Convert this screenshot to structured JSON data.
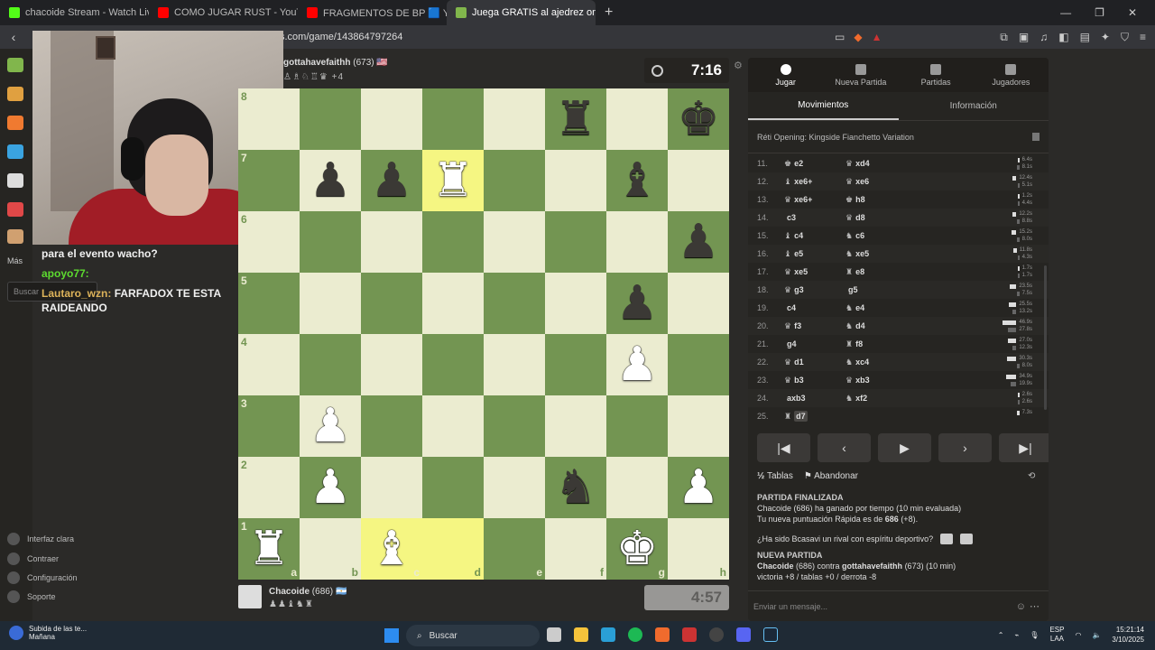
{
  "browser": {
    "tabs": [
      {
        "title": "chacoide Stream - Watch Live on",
        "color": "#53fc18"
      },
      {
        "title": "COMO JUGAR RUST - YouTube",
        "color": "#ff0000"
      },
      {
        "title": "FRAGMENTOS DE BP 🟦 Y ❌CRO",
        "color": "#ff0000"
      },
      {
        "title": "Juega GRATIS al ajedrez online -",
        "color": "#81b64c"
      }
    ],
    "url": "s.com/game/143864797264"
  },
  "sidebar": {
    "mas": "Más",
    "search_placeholder": "Buscar",
    "bottom": [
      "Interfaz clara",
      "Contraer",
      "Configuración",
      "Soporte"
    ]
  },
  "chat": [
    {
      "user": "",
      "text": "para el evento wacho?"
    },
    {
      "user": "apoyo77:",
      "text": "",
      "color": "green"
    },
    {
      "user": "Lautaro_wzn:",
      "text": "FARFADOX TE ESTA RAIDEANDO",
      "color": "orange"
    }
  ],
  "game": {
    "opponent": {
      "name": "gottahavefaithh",
      "rating": "(673)",
      "flag": "🇺🇸",
      "captured": "♙♗♘♖♛ +4"
    },
    "player": {
      "name": "Chacoide",
      "rating": "(686)",
      "flag": "🇦🇷",
      "captured": "♟♟♝♞♜"
    },
    "clock_top": "7:16",
    "clock_bottom": "4:57"
  },
  "board": {
    "ranks": [
      "8",
      "7",
      "6",
      "5",
      "4",
      "3",
      "2",
      "1"
    ],
    "files": [
      "a",
      "b",
      "c",
      "d",
      "e",
      "f",
      "g",
      "h"
    ],
    "position": [
      [
        "",
        "",
        "",
        "",
        "",
        "br",
        "",
        "bk"
      ],
      [
        "",
        "bp",
        "bp",
        "wr",
        "",
        "",
        "bb",
        ""
      ],
      [
        "",
        "",
        "",
        "",
        "",
        "",
        "",
        "bp"
      ],
      [
        "",
        "",
        "",
        "",
        "",
        "",
        "bp",
        ""
      ],
      [
        "",
        "",
        "",
        "",
        "",
        "",
        "wp",
        ""
      ],
      [
        "",
        "wp",
        "",
        "",
        "",
        "",
        "",
        ""
      ],
      [
        "",
        "wp",
        "",
        "",
        "",
        "bn",
        "",
        "wp"
      ],
      [
        "wr",
        "",
        "wb",
        "",
        "",
        "",
        "wk",
        ""
      ]
    ],
    "highlight": [
      "d7",
      "c1",
      "d1"
    ]
  },
  "panel": {
    "tabs": [
      "Jugar",
      "Nueva Partida",
      "Partidas",
      "Jugadores"
    ],
    "subtabs": [
      "Movimientos",
      "Información"
    ],
    "opening": "Réti Opening: Kingside Fianchetto Variation",
    "moves": [
      {
        "n": "11.",
        "w": "e2",
        "wp": "♚",
        "b": "xd4",
        "bp": "♛",
        "tw": "6.4s",
        "tb": "8.1s"
      },
      {
        "n": "12.",
        "w": "xe6+",
        "wp": "♝",
        "b": "xe6",
        "bp": "♛",
        "tw": "12.4s",
        "tb": "5.1s"
      },
      {
        "n": "13.",
        "w": "xe6+",
        "wp": "♛",
        "b": "h8",
        "bp": "♚",
        "tw": "1.2s",
        "tb": "4.4s"
      },
      {
        "n": "14.",
        "w": "c3",
        "wp": "",
        "b": "d8",
        "bp": "♛",
        "tw": "12.2s",
        "tb": "8.8s"
      },
      {
        "n": "15.",
        "w": "c4",
        "wp": "♝",
        "b": "c6",
        "bp": "♞",
        "tw": "15.2s",
        "tb": "8.0s"
      },
      {
        "n": "16.",
        "w": "e5",
        "wp": "♝",
        "b": "xe5",
        "bp": "♞",
        "tw": "11.8s",
        "tb": "4.3s"
      },
      {
        "n": "17.",
        "w": "xe5",
        "wp": "♛",
        "b": "e8",
        "bp": "♜",
        "tw": "1.7s",
        "tb": "1.7s"
      },
      {
        "n": "18.",
        "w": "g3",
        "wp": "♛",
        "b": "g5",
        "bp": "",
        "tw": "23.5s",
        "tb": "7.5s"
      },
      {
        "n": "19.",
        "w": "c4",
        "wp": "",
        "b": "e4",
        "bp": "♞",
        "tw": "25.5s",
        "tb": "13.2s"
      },
      {
        "n": "20.",
        "w": "f3",
        "wp": "♛",
        "b": "d4",
        "bp": "♞",
        "tw": "46.9s",
        "tb": "27.8s"
      },
      {
        "n": "21.",
        "w": "g4",
        "wp": "",
        "b": "f8",
        "bp": "♜",
        "tw": "27.0s",
        "tb": "12.3s"
      },
      {
        "n": "22.",
        "w": "d1",
        "wp": "♛",
        "b": "xc4",
        "bp": "♞",
        "tw": "30.3s",
        "tb": "8.0s"
      },
      {
        "n": "23.",
        "w": "b3",
        "wp": "♛",
        "b": "xb3",
        "bp": "♛",
        "tw": "34.9s",
        "tb": "19.9s"
      },
      {
        "n": "24.",
        "w": "axb3",
        "wp": "",
        "b": "xf2",
        "bp": "♞",
        "tw": "2.6s",
        "tb": "2.6s"
      },
      {
        "n": "25.",
        "w": "d7",
        "wp": "♜",
        "b": "",
        "bp": "",
        "tw": "7.3s",
        "tb": ""
      }
    ],
    "draw": "Tablas",
    "resign": "Abandonar",
    "log": {
      "h1": "PARTIDA FINALIZADA",
      "l1": "Chacoide (686) ha ganado por tiempo (10 min evaluada)",
      "l2a": "Tu nueva puntuación Rápida es de ",
      "l2b": "686",
      "l2c": " (+8).",
      "q": "¿Ha sido Bcasavi un rival con espíritu deportivo?",
      "h2": "NUEVA PARTIDA",
      "l3a": "Chacoide",
      "l3b": " (686) contra ",
      "l3c": "gottahavefaithh",
      "l3d": " (673) (10 min)",
      "l4": "victoria +8 / tablas +0 / derrota -8"
    },
    "message_placeholder": "Enviar un mensaje..."
  },
  "taskbar": {
    "weather1": "Subida de las te...",
    "weather2": "Mañana",
    "search": "Buscar",
    "lang1": "ESP",
    "lang2": "LAA",
    "time": "15:21:14",
    "date": "3/10/2025"
  }
}
